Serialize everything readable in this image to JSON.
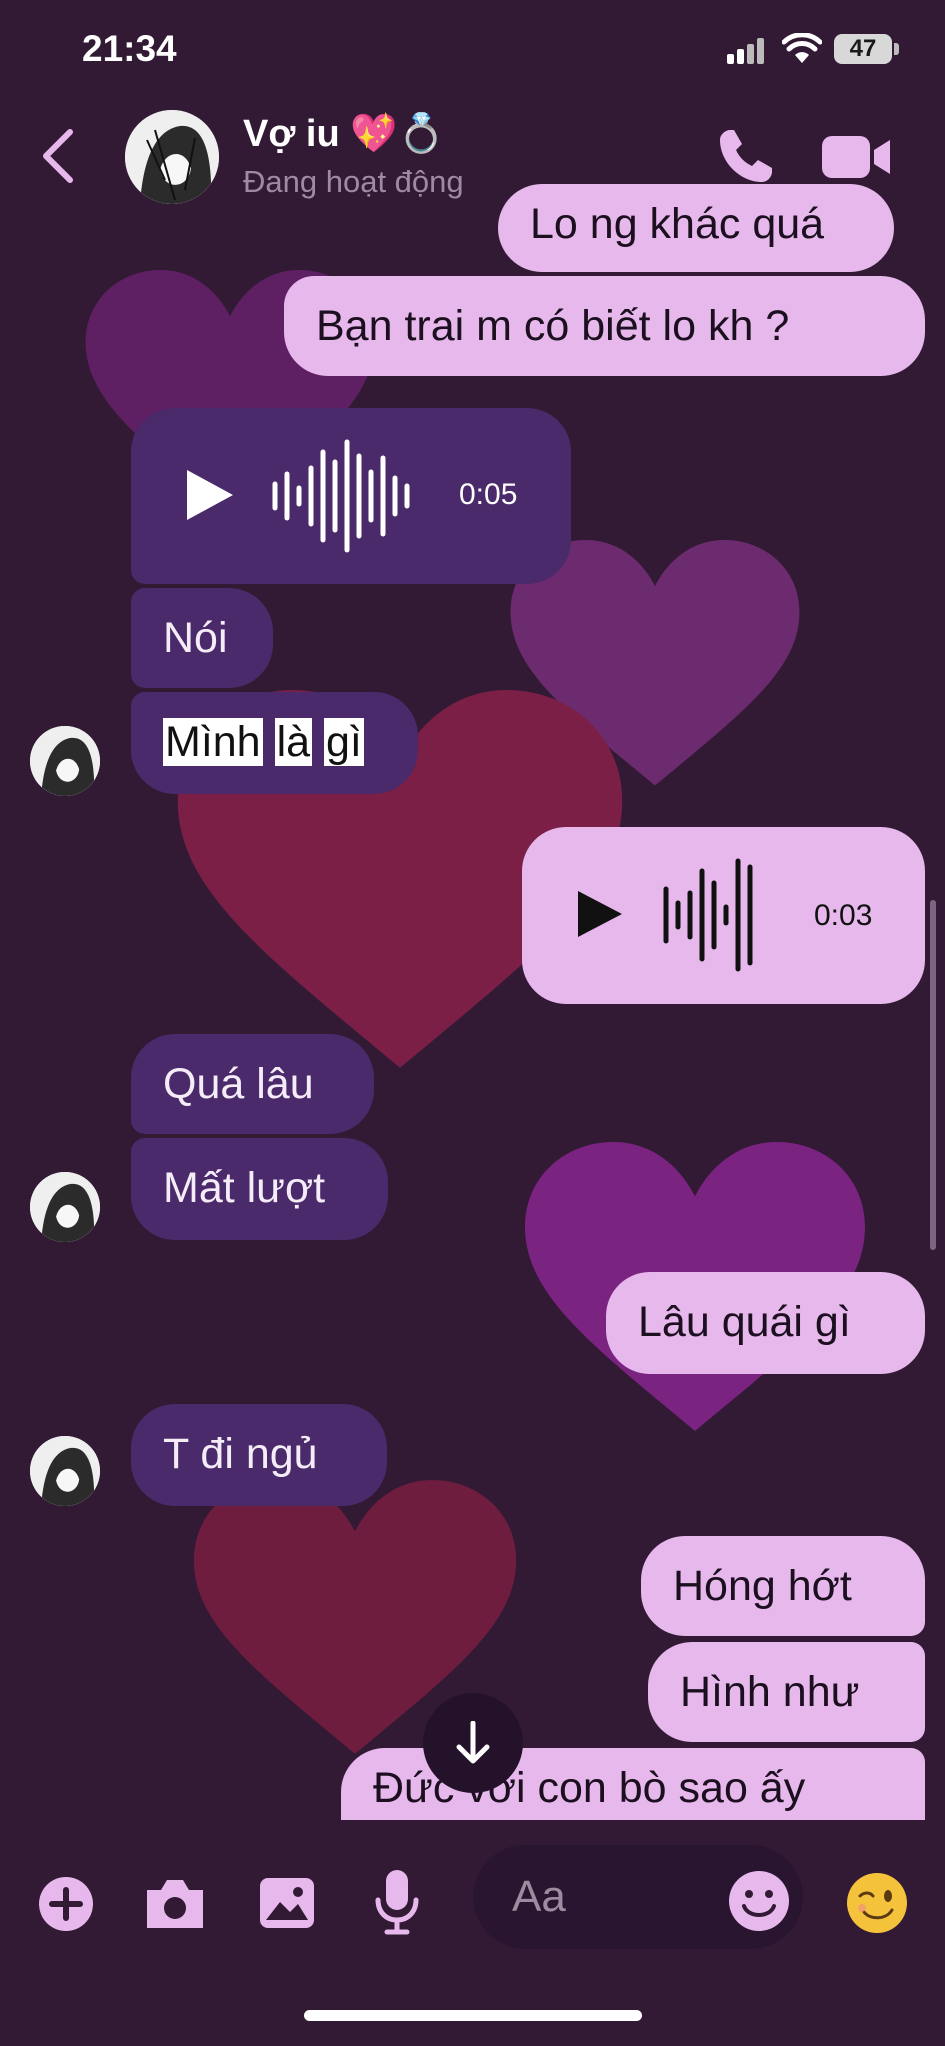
{
  "status_bar": {
    "time": "21:34",
    "battery": "47"
  },
  "header": {
    "contact_name": "Vợ iu 💖💍",
    "contact_status": "Đang hoạt động"
  },
  "messages": [
    {
      "side": "out",
      "type": "text",
      "text": "Lo ng khác quá"
    },
    {
      "side": "out",
      "type": "text",
      "text": "Bạn trai m có biết lo kh ?"
    },
    {
      "side": "in",
      "type": "voice",
      "duration": "0:05"
    },
    {
      "side": "in",
      "type": "text",
      "text": "Nói"
    },
    {
      "side": "in",
      "type": "text",
      "words": [
        "Mình",
        "là",
        "gì"
      ]
    },
    {
      "side": "out",
      "type": "voice",
      "duration": "0:03"
    },
    {
      "side": "in",
      "type": "text",
      "text": "Quá lâu"
    },
    {
      "side": "in",
      "type": "text",
      "text": "Mất lượt"
    },
    {
      "side": "out",
      "type": "text",
      "text": "Lâu quái gì"
    },
    {
      "side": "in",
      "type": "text",
      "text": "T đi ngủ"
    },
    {
      "side": "out",
      "type": "text",
      "text": "Hóng hớt"
    },
    {
      "side": "out",
      "type": "text",
      "text": "Hình như"
    },
    {
      "side": "out",
      "type": "text",
      "text": "Đức với con bò sao ấy"
    }
  ],
  "composer": {
    "placeholder": "Aa"
  },
  "colors": {
    "background": "#321a35",
    "outgoing_bubble": "#e7b8ec",
    "incoming_bubble": "#4b2a6b",
    "accent": "#e7b8ec"
  }
}
